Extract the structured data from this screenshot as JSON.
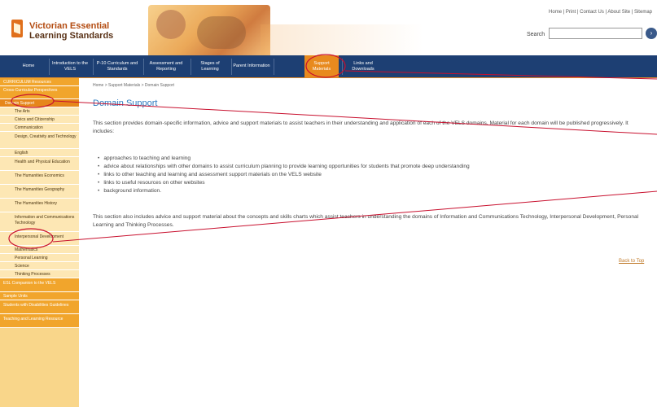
{
  "header": {
    "logo_line1": "Victorian Essential",
    "logo_line2": "Learning Standards",
    "toplinks": "Home | Print | Contact Us | About Site | Sitemap",
    "search_label": "Search",
    "search_value": "",
    "search_go_icon": "go-circle-icon"
  },
  "nav": {
    "items": [
      {
        "label": "Home"
      },
      {
        "label": "Introduction to the VELS"
      },
      {
        "label": "P-10 Curriculum and Standards"
      },
      {
        "label": "Assessment and Reporting"
      },
      {
        "label": "Stages of Learning"
      },
      {
        "label": "Parent Information"
      },
      {
        "label": "Support Materials"
      },
      {
        "label": "Links and Downloads"
      }
    ],
    "active_index": 6
  },
  "sidebar": {
    "items": [
      {
        "label": "CURRICULUM Resources",
        "type": "top"
      },
      {
        "label": "Cross-Curricular Perspectives",
        "type": "top"
      },
      {
        "label": "Domain Support",
        "type": "active"
      },
      {
        "label": "The Arts",
        "type": "sub"
      },
      {
        "label": "Civics and Citizenship",
        "type": "sub"
      },
      {
        "label": "Communication",
        "type": "sub"
      },
      {
        "label": "Design, Creativity and Technology",
        "type": "sub"
      },
      {
        "label": "English",
        "type": "sub"
      },
      {
        "label": "Health and Physical Education",
        "type": "sub"
      },
      {
        "label": "The Humanities Economics",
        "type": "sub"
      },
      {
        "label": "The Humanities Geography",
        "type": "sub"
      },
      {
        "label": "The Humanities History",
        "type": "sub"
      },
      {
        "label": "Information and Communications Technology",
        "type": "sub"
      },
      {
        "label": "Interpersonal Development",
        "type": "sub"
      },
      {
        "label": "Mathematics",
        "type": "sub"
      },
      {
        "label": "Personal Learning",
        "type": "sub"
      },
      {
        "label": "Science",
        "type": "sub"
      },
      {
        "label": "Thinking Processes",
        "type": "sub"
      },
      {
        "label": "ESL Companion to the VELS",
        "type": "top"
      },
      {
        "label": "Sample Units",
        "type": "top"
      },
      {
        "label": "Students with Disabilities Guidelines",
        "type": "top"
      },
      {
        "label": "Teaching and Learning Resource",
        "type": "top"
      }
    ]
  },
  "content": {
    "breadcrumb": "Home > Support Materials > Domain Support",
    "title": "Domain Support",
    "intro": "This section provides domain-specific information, advice and support materials to assist teachers in their understanding and application of each of the VELS domains. Material for each domain will be published progressively. It includes:",
    "bullets": [
      "approaches to teaching and learning",
      "advice about relationships with other domains to assist curriculum planning to provide learning opportunities for students that promote deep understanding",
      "links to other teaching and learning and assessment support materials on the VELS website",
      "links to useful resources on other websites",
      "background information."
    ],
    "closing": "This section also includes advice and support material about the concepts and skills charts which assist teachers in understanding the domains of Information and Communications Technology, Interpersonal Development, Personal Learning and Thinking Processes.",
    "back_to_top": "Back to Top"
  },
  "colors": {
    "nav_bg": "#1d3f73",
    "nav_active": "#e88a1e",
    "sidebar_bg": "#f9d68a",
    "title": "#2c7bc0",
    "annotation": "#c8102e"
  }
}
